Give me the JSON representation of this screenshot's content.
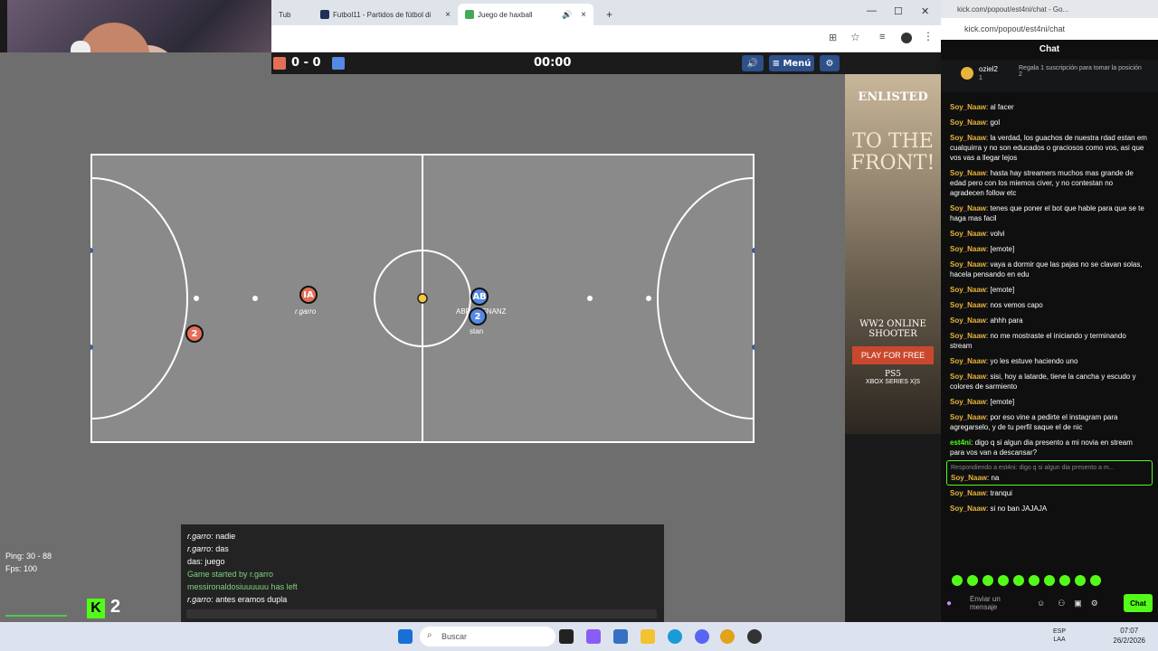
{
  "browser": {
    "tabs": [
      {
        "label": "Tub"
      },
      {
        "label": "Futbol11 - Partidos de fútbol di"
      },
      {
        "label": "Juego de haxball"
      }
    ],
    "new_tab": "+",
    "close": "×"
  },
  "game": {
    "score": "0 - 0",
    "timer": "00:00",
    "menu_label": "Menú",
    "team_colors": {
      "red": "#e56e56",
      "blue": "#5689e5"
    },
    "players": [
      {
        "label": "IA",
        "name": "r.garro",
        "team": "red"
      },
      {
        "label": "2",
        "name": "",
        "team": "red"
      },
      {
        "label": "AB",
        "name": "ABRAMSNANZ",
        "team": "blue"
      },
      {
        "label": "2",
        "name": "stan",
        "team": "blue"
      }
    ],
    "ping": "Ping: 30 - 88",
    "fps": "Fps: 100",
    "k_number": "2"
  },
  "game_chat": [
    {
      "user": "r.garro",
      "text": "nadie"
    },
    {
      "user": "r.garro",
      "text": "das"
    },
    {
      "user": "",
      "text": "das: juego"
    },
    {
      "user": "",
      "text": "Game started by r.garro",
      "system": true
    },
    {
      "user": "",
      "text": "messironaldosiuuuuuu has left",
      "system": true
    },
    {
      "user": "r.garro",
      "text": "antes eramos dupla"
    }
  ],
  "ad": {
    "brand": "ENLISTED",
    "headline": "TO THE FRONT!",
    "tagline": "WW2 ONLINE SHOOTER",
    "cta": "PLAY FOR FREE",
    "platforms": "PS5",
    "platforms2": "XBOX SERIES X|S"
  },
  "kick": {
    "window_title": "kick.com/popout/est4ni/chat - Go...",
    "url": "kick.com/popout/est4ni/chat",
    "header": "Chat",
    "sub_user": "oziel2",
    "sub_count": "1",
    "sub_text": "Regala 1 suscripción para tomar la posición 2",
    "messages": [
      {
        "user": "Soy_Naaw",
        "text": "al facer"
      },
      {
        "user": "Soy_Naaw",
        "text": "gol"
      },
      {
        "user": "Soy_Naaw",
        "text": "la verdad, los guachos de nuestra rdad estan em cualquirra y no son educados o graciosos como vos, asi que vos vas a llegar lejos"
      },
      {
        "user": "Soy_Naaw",
        "text": "hasta hay streamers muchos mas grande de edad pero con los miemos civer, y no contestan no agradecen follow etc"
      },
      {
        "user": "Soy_Naaw",
        "text": "tenes que poner el bot que hable para que se te haga mas facil"
      },
      {
        "user": "Soy_Naaw",
        "text": "volvi"
      },
      {
        "user": "Soy_Naaw",
        "text": "[emote]"
      },
      {
        "user": "Soy_Naaw",
        "text": "vaya a dormir que las pajas no se clavan solas, hacela pensando en edu"
      },
      {
        "user": "Soy_Naaw",
        "text": "[emote]"
      },
      {
        "user": "Soy_Naaw",
        "text": "nos vemos capo"
      },
      {
        "user": "Soy_Naaw",
        "text": "ahhh para"
      },
      {
        "user": "Soy_Naaw",
        "text": "no me mostraste el iniciando y terminando stream"
      },
      {
        "user": "Soy_Naaw",
        "text": "yo les estuve haciendo uno"
      },
      {
        "user": "Soy_Naaw",
        "text": "sisi, hoy a latarde, tiene la cancha y escudo y colores de sarmiento"
      },
      {
        "user": "Soy_Naaw",
        "text": "[emote]"
      },
      {
        "user": "Soy_Naaw",
        "text": "por eso vine a pedirte el instagram para agregarselo, y de tu perfil saque el de nic"
      },
      {
        "user": "est4ni",
        "text": "digo q si algun dia presento a mi novia en stream para vos van a descansar?",
        "green": true
      },
      {
        "user": "Soy_Naaw",
        "text": "na",
        "reply": "Respondiendo a est4ni: digo q si algun dia presento a m..."
      },
      {
        "user": "Soy_Naaw",
        "text": "tranqui"
      },
      {
        "user": "Soy_Naaw",
        "text": "si no ban JAJAJA"
      }
    ],
    "input_placeholder": "Enviar un mensaje",
    "chat_button": "Chat"
  },
  "taskbar": {
    "search": "Buscar",
    "lang": "ESP",
    "lang2": "LAA",
    "time": "07:07",
    "date": "26/2/2026"
  }
}
